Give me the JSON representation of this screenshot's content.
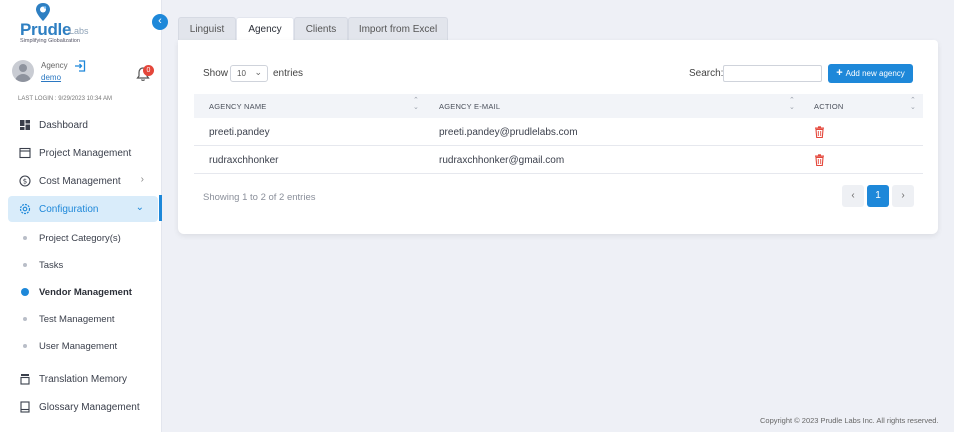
{
  "brand": {
    "name": "Prudle",
    "suffix": "Labs",
    "tagline": "Simplifying Globalization",
    "accent_color": "#1e88d9"
  },
  "user": {
    "role": "Agency",
    "name": "demo",
    "notification_count": "0",
    "last_login": "LAST LOGIN : 9/29/2023 10:34 AM"
  },
  "sidebar": {
    "items": [
      {
        "label": "Dashboard",
        "icon": "dashboard-icon"
      },
      {
        "label": "Project Management",
        "icon": "folder-icon"
      },
      {
        "label": "Cost Management",
        "icon": "dollar-icon",
        "chevron": ">"
      },
      {
        "label": "Configuration",
        "icon": "gear-icon",
        "chevron": "v"
      },
      {
        "label": "Translation Memory",
        "icon": "database-icon"
      },
      {
        "label": "Glossary Management",
        "icon": "book-icon"
      }
    ],
    "sub_items": [
      {
        "label": "Project Category(s)"
      },
      {
        "label": "Tasks"
      },
      {
        "label": "Vendor Management"
      },
      {
        "label": "Test Management"
      },
      {
        "label": "User Management"
      }
    ]
  },
  "tabs": [
    {
      "label": "Linguist"
    },
    {
      "label": "Agency"
    },
    {
      "label": "Clients"
    },
    {
      "label": "Import from Excel"
    }
  ],
  "toolbar": {
    "show_label": "Show",
    "entries_value": "10",
    "entries_label": "entries",
    "search_label": "Search:",
    "search_value": "",
    "add_button": "Add new agency"
  },
  "table": {
    "columns": [
      "AGENCY NAME",
      "AGENCY E-MAIL",
      "ACTION"
    ],
    "rows": [
      {
        "name": "preeti.pandey",
        "email": "preeti.pandey@prudlelabs.com"
      },
      {
        "name": "rudraxchhonker",
        "email": "rudraxchhonker@gmail.com"
      }
    ]
  },
  "pagination": {
    "info": "Showing 1 to 2 of 2 entries",
    "prev": "‹",
    "current": "1",
    "next": "›"
  },
  "footer": {
    "copyright": "Copyright © 2023 Prudle Labs Inc. All rights reserved."
  }
}
